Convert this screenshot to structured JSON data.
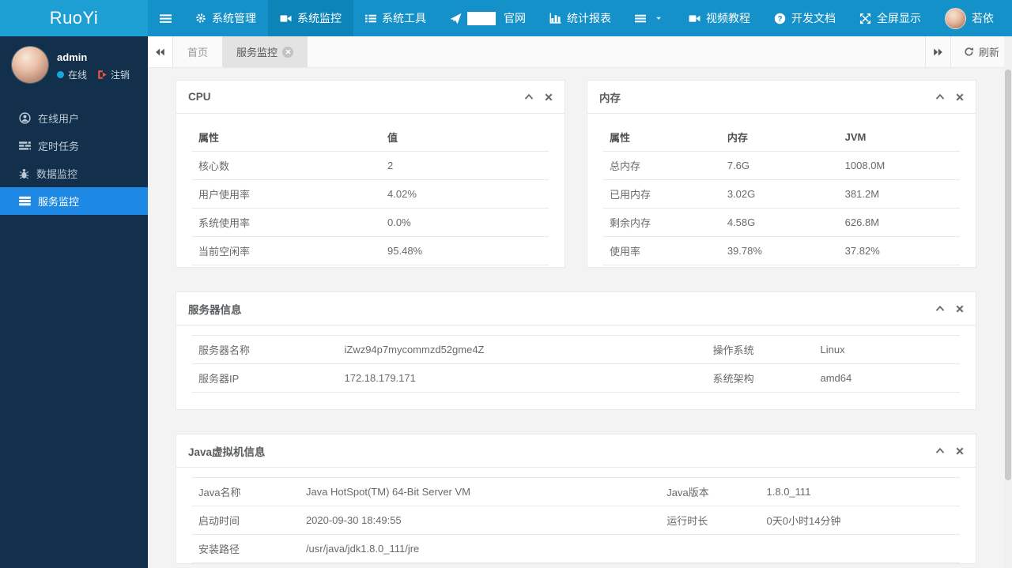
{
  "navbar": {
    "logo": "RuoYi",
    "items": [
      {
        "label": "系统管理"
      },
      {
        "label": "系统监控"
      },
      {
        "label": "系统工具"
      },
      {
        "label": "官网"
      },
      {
        "label": "统计报表"
      }
    ],
    "right": [
      {
        "label": "视频教程"
      },
      {
        "label": "开发文档"
      },
      {
        "label": "全屏显示"
      },
      {
        "label": "若依"
      }
    ]
  },
  "sidebar": {
    "user": {
      "name": "admin",
      "status": "在线",
      "logout": "注销"
    },
    "items": [
      {
        "label": "在线用户"
      },
      {
        "label": "定时任务"
      },
      {
        "label": "数据监控"
      },
      {
        "label": "服务监控",
        "active": true
      }
    ]
  },
  "tabbar": {
    "tabs": [
      {
        "label": "首页"
      },
      {
        "label": "服务监控",
        "active": true
      }
    ],
    "refresh_label": "刷新"
  },
  "panels": {
    "cpu": {
      "title": "CPU",
      "headers": [
        "属性",
        "值"
      ],
      "rows": [
        [
          "核心数",
          "2"
        ],
        [
          "用户使用率",
          "4.02%"
        ],
        [
          "系统使用率",
          "0.0%"
        ],
        [
          "当前空闲率",
          "95.48%"
        ]
      ]
    },
    "memory": {
      "title": "内存",
      "headers": [
        "属性",
        "内存",
        "JVM"
      ],
      "rows": [
        [
          "总内存",
          "7.6G",
          "1008.0M"
        ],
        [
          "已用内存",
          "3.02G",
          "381.2M"
        ],
        [
          "剩余内存",
          "4.58G",
          "626.8M"
        ],
        [
          "使用率",
          "39.78%",
          "37.82%"
        ]
      ]
    },
    "server": {
      "title": "服务器信息",
      "rows": [
        [
          "服务器名称",
          "iZwz94p7mycommzd52gme4Z",
          "操作系统",
          "Linux"
        ],
        [
          "服务器IP",
          "172.18.179.171",
          "系统架构",
          "amd64"
        ]
      ]
    },
    "jvm": {
      "title": "Java虚拟机信息",
      "rows": [
        [
          "Java名称",
          "Java HotSpot(TM) 64-Bit Server VM",
          "Java版本",
          "1.8.0_111"
        ],
        [
          "启动时间",
          "2020-09-30 18:49:55",
          "运行时长",
          "0天0小时14分钟"
        ],
        [
          "安装路径",
          "/usr/java/jdk1.8.0_111/jre",
          "",
          ""
        ]
      ]
    }
  },
  "colors": {
    "navbar": "#1391c8",
    "logo_bg": "#1d9fd4",
    "nav_active": "#0d84b8",
    "sidebar_bg": "#12304b",
    "sidebar_active": "#1e88e5",
    "online_dot": "#19a6e0",
    "logout_red": "#e9573f",
    "content_bg": "#f3f3f4",
    "panel_border": "#e7eaec",
    "text": "#676a6c"
  }
}
